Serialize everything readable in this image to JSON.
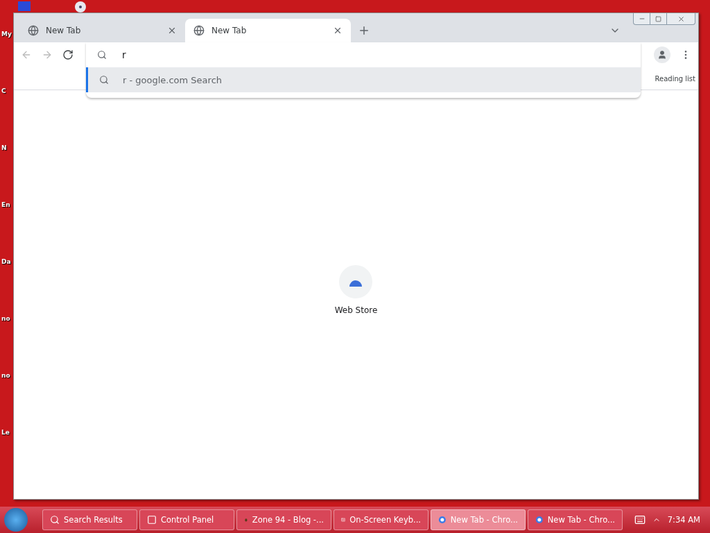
{
  "desktop_labels": [
    {
      "text": "My"
    },
    {
      "text": "C"
    },
    {
      "text": "N"
    },
    {
      "text": "En"
    },
    {
      "text": "Da"
    },
    {
      "text": "no"
    },
    {
      "text": "no"
    },
    {
      "text": "Le"
    }
  ],
  "browser": {
    "tabs": [
      {
        "title": "New Tab",
        "selected": false
      },
      {
        "title": "New Tab",
        "selected": true
      }
    ],
    "omnibox": {
      "value": "r",
      "suggestions": [
        {
          "text": "r - google.com Search",
          "selected": true
        }
      ]
    },
    "reading_list": "Reading list",
    "shortcuts": [
      {
        "label": "Web Store"
      }
    ]
  },
  "taskbar": {
    "items": [
      {
        "label": "Search Results",
        "kind": "search",
        "selected": false
      },
      {
        "label": "Control Panel",
        "kind": "panel",
        "selected": false
      },
      {
        "label": "Zone 94 - Blog -...",
        "kind": "blog",
        "selected": false
      },
      {
        "label": "On-Screen Keyb...",
        "kind": "keyboard",
        "selected": false
      },
      {
        "label": "New Tab - Chro...",
        "kind": "browser",
        "selected": true
      },
      {
        "label": "New Tab - Chro...",
        "kind": "browser",
        "selected": false
      }
    ],
    "clock": "7:34 AM"
  }
}
